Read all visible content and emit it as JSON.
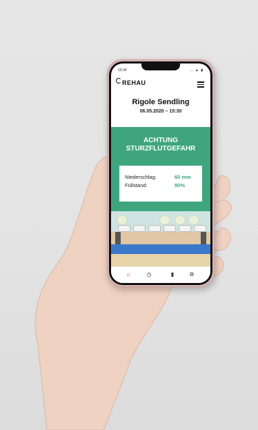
{
  "status_bar": {
    "time": "15:34",
    "icons": "… ▲ ▮"
  },
  "app": {
    "brand": "REHAU"
  },
  "header": {
    "title": "Rigole Sendling",
    "datetime": "06.05.2020 – 15:30"
  },
  "alert": {
    "text": "ACHTUNG\nSTURZFLUTGEFAHR",
    "color": "#3ea57f"
  },
  "metrics": {
    "rows": [
      {
        "label": "Niederschlag:",
        "value": "60 mm"
      },
      {
        "label": "Füllstand:",
        "value": "90%"
      }
    ]
  },
  "bottom_nav": {
    "items": [
      {
        "name": "home",
        "icon": "home-icon",
        "active": true,
        "color": "#e3007f"
      },
      {
        "name": "history",
        "icon": "clock-icon"
      },
      {
        "name": "stats",
        "icon": "bar-chart-icon"
      },
      {
        "name": "settings",
        "icon": "settings-icon"
      }
    ]
  }
}
